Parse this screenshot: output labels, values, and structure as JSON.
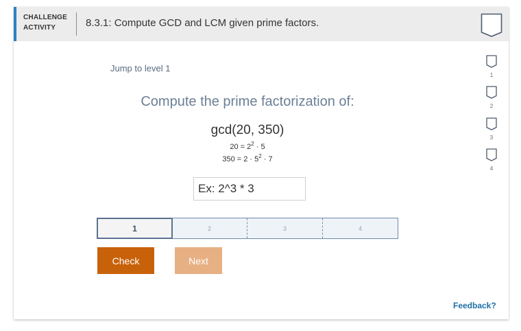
{
  "header": {
    "activity_label": "CHALLENGE ACTIVITY",
    "title": "8.3.1: Compute GCD and LCM given prime factors."
  },
  "jump_link": "Jump to level 1",
  "prompt": "Compute the prime factorization of:",
  "expression": "gcd(20, 350)",
  "factorizations": {
    "first_lhs": "20 = 2",
    "first_exp": "2",
    "first_rest": " · 5",
    "second_lhs": "350 = 2 · 5",
    "second_exp": "2",
    "second_rest": " · 7"
  },
  "answer_input": {
    "placeholder": "Ex: 2^3 * 3",
    "value": ""
  },
  "levels": [
    "1",
    "2",
    "3",
    "4"
  ],
  "active_level": "1",
  "buttons": {
    "check": "Check",
    "next": "Next"
  },
  "side_levels": [
    "1",
    "2",
    "3",
    "4"
  ],
  "feedback": "Feedback?",
  "colors": {
    "accent_bar": "#2e82c4",
    "check_button": "#c8620a",
    "next_button_disabled": "#e7b083",
    "feedback_link": "#1d6fa5"
  }
}
